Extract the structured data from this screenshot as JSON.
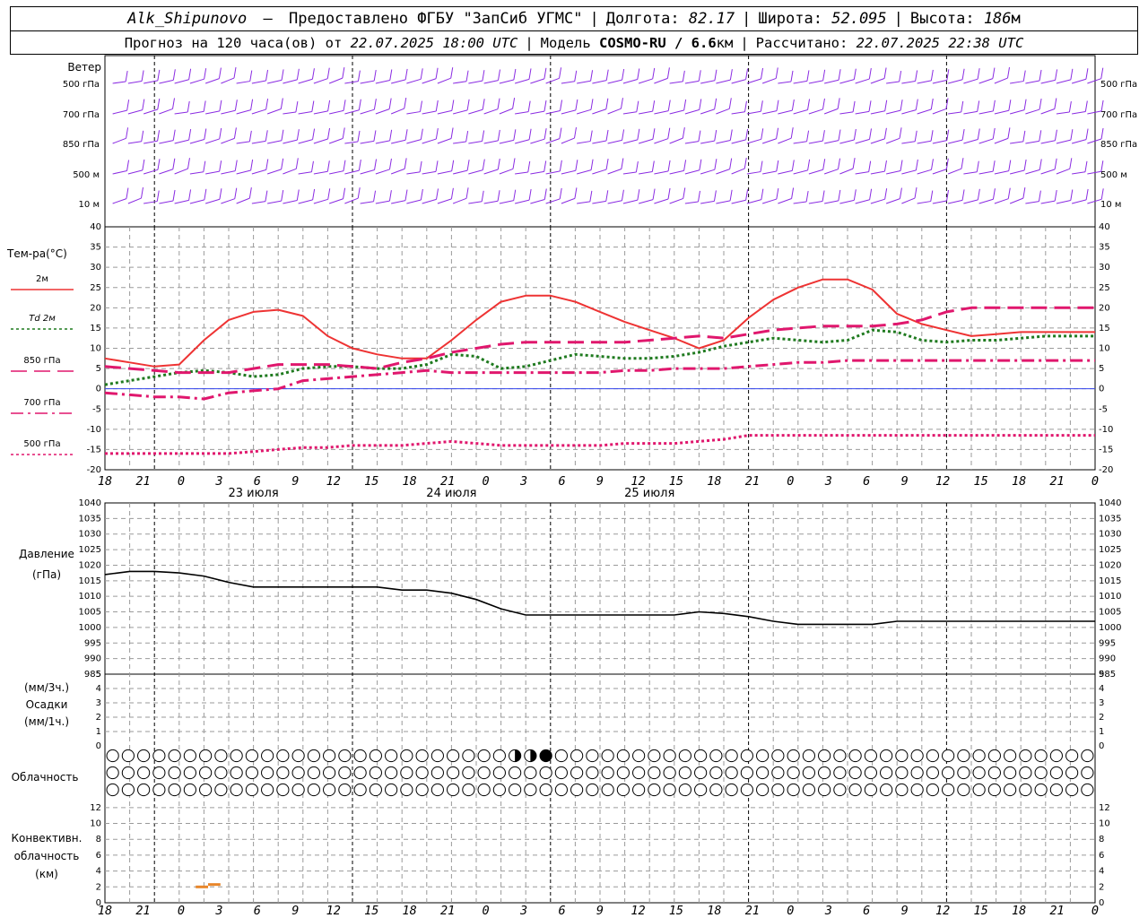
{
  "header": {
    "station": "Alk_Shipunovo",
    "provider": "Предоставлено ФГБУ \"ЗапСиб УГМС\"",
    "lon_label": "Долгота:",
    "lon_value": "82.17",
    "lat_label": "Широта:",
    "lat_value": "52.095",
    "alt_label": "Высота:",
    "alt_value": "186",
    "alt_unit": "м",
    "forecast_prefix": "Прогноз на 120 часа(ов) от",
    "forecast_time": "22.07.2025 18:00 UTC",
    "model_label": "Модель",
    "model_name": "COSMO-RU / 6.6",
    "model_unit": "км",
    "calc_label": "Рассчитано:",
    "calc_time": "22.07.2025 22:38 UTC"
  },
  "chart_data": [
    {
      "type": "wind-barbs",
      "label": "Ветер",
      "levels": [
        "500 гПа",
        "700 гПа",
        "850 гПа",
        "500 м",
        "10 м"
      ],
      "colors": {
        "barb": "#8a2be2"
      },
      "barbs_per_level": 64
    },
    {
      "type": "line",
      "label": "Тем-ра(°С)",
      "ylim": [
        -20,
        40
      ],
      "yticks": [
        -20,
        -15,
        -10,
        -5,
        0,
        5,
        10,
        15,
        20,
        25,
        30,
        35,
        40
      ],
      "x_hours": [
        0,
        120
      ],
      "series": [
        {
          "name": "2м",
          "color": "#ee3333",
          "style": "solid",
          "width": 2,
          "x": [
            0,
            3,
            6,
            9,
            12,
            15,
            18,
            21,
            24,
            27,
            30,
            33,
            36,
            39,
            42,
            45,
            48,
            51,
            54,
            57,
            60,
            63,
            66,
            69,
            72,
            75,
            78,
            81,
            84,
            87,
            90,
            93,
            96,
            99,
            102,
            105,
            108,
            111,
            114,
            117,
            120
          ],
          "y": [
            7.5,
            6.5,
            5.5,
            6,
            12,
            17,
            19,
            19.5,
            18,
            13,
            10,
            8.5,
            7.5,
            7.5,
            12,
            17,
            21.5,
            23,
            23,
            21.5,
            19,
            16.5,
            14.5,
            12.5,
            10,
            12,
            17.5,
            22,
            25,
            27,
            27,
            24.5,
            18.5,
            16,
            14.5,
            13,
            13.5,
            14,
            14,
            14,
            14
          ]
        },
        {
          "name": "Td 2м",
          "color": "#1f7a1f",
          "style": "dotted",
          "width": 3,
          "x": [
            0,
            3,
            6,
            9,
            12,
            15,
            18,
            21,
            24,
            27,
            30,
            33,
            36,
            39,
            42,
            45,
            48,
            51,
            54,
            57,
            60,
            63,
            66,
            69,
            72,
            75,
            78,
            81,
            84,
            87,
            90,
            93,
            96,
            99,
            102,
            105,
            108,
            111,
            114,
            117,
            120
          ],
          "y": [
            1,
            2,
            3,
            4,
            4.5,
            4,
            3,
            3.5,
            5,
            5.5,
            5.5,
            5,
            5,
            6,
            8.5,
            8,
            5,
            5.5,
            7,
            8.5,
            8,
            7.5,
            7.5,
            8,
            9,
            10.5,
            11.5,
            12.5,
            12,
            11.5,
            12,
            14.5,
            14,
            12,
            11.5,
            12,
            12,
            12.5,
            13,
            13,
            13
          ]
        },
        {
          "name": "850 гПа",
          "color": "#e0176d",
          "style": "longdash",
          "width": 3,
          "x": [
            0,
            3,
            6,
            9,
            12,
            15,
            18,
            21,
            24,
            27,
            30,
            33,
            36,
            39,
            42,
            45,
            48,
            51,
            54,
            57,
            60,
            63,
            66,
            69,
            72,
            75,
            78,
            81,
            84,
            87,
            90,
            93,
            96,
            99,
            102,
            105,
            108,
            111,
            114,
            117,
            120
          ],
          "y": [
            5.5,
            5,
            4.5,
            4,
            4,
            4,
            5,
            6,
            6,
            6,
            5.5,
            5,
            6.5,
            7.5,
            9,
            10,
            11,
            11.5,
            11.5,
            11.5,
            11.5,
            11.5,
            12,
            12.5,
            13,
            12.5,
            13.5,
            14.5,
            15,
            15.5,
            15.5,
            15.5,
            16,
            17,
            19,
            20,
            20,
            20,
            20,
            20,
            20
          ]
        },
        {
          "name": "700 гПа",
          "color": "#e0176d",
          "style": "dashdot",
          "width": 3,
          "x": [
            0,
            3,
            6,
            9,
            12,
            15,
            18,
            21,
            24,
            27,
            30,
            33,
            36,
            39,
            42,
            45,
            48,
            51,
            54,
            57,
            60,
            63,
            66,
            69,
            72,
            75,
            78,
            81,
            84,
            87,
            90,
            93,
            96,
            99,
            102,
            105,
            108,
            111,
            114,
            117,
            120
          ],
          "y": [
            -1,
            -1.5,
            -2,
            -2,
            -2.5,
            -1,
            -0.5,
            0,
            2,
            2.5,
            3,
            3.5,
            4,
            4.5,
            4,
            4,
            4,
            4,
            4,
            4,
            4,
            4.5,
            4.5,
            5,
            5,
            5,
            5.5,
            6,
            6.5,
            6.5,
            7,
            7,
            7,
            7,
            7,
            7,
            7,
            7,
            7,
            7,
            7
          ]
        },
        {
          "name": "500 гПа",
          "color": "#e0176d",
          "style": "dotted",
          "width": 3,
          "x": [
            0,
            3,
            6,
            9,
            12,
            15,
            18,
            21,
            24,
            27,
            30,
            33,
            36,
            39,
            42,
            45,
            48,
            51,
            54,
            57,
            60,
            63,
            66,
            69,
            72,
            75,
            78,
            81,
            84,
            87,
            90,
            93,
            96,
            99,
            102,
            105,
            108,
            111,
            114,
            117,
            120
          ],
          "y": [
            -16,
            -16,
            -16,
            -16,
            -16,
            -16,
            -15.5,
            -15,
            -14.5,
            -14.5,
            -14,
            -14,
            -14,
            -13.5,
            -13,
            -13.5,
            -14,
            -14,
            -14,
            -14,
            -14,
            -13.5,
            -13.5,
            -13.5,
            -13,
            -12.5,
            -11.5,
            -11.5,
            -11.5,
            -11.5,
            -11.5,
            -11.5,
            -11.5,
            -11.5,
            -11.5,
            -11.5,
            -11.5,
            -11.5,
            -11.5,
            -11.5,
            -11.5
          ]
        }
      ]
    },
    {
      "type": "line",
      "label_1": "Давление",
      "label_2": "(гПа)",
      "ylim": [
        985,
        1040
      ],
      "yticks": [
        985,
        990,
        995,
        1000,
        1005,
        1010,
        1015,
        1020,
        1025,
        1030,
        1035,
        1040
      ],
      "series": [
        {
          "name": "",
          "color": "#000000",
          "x": [
            0,
            3,
            6,
            9,
            12,
            15,
            18,
            21,
            24,
            27,
            30,
            33,
            36,
            39,
            42,
            45,
            48,
            51,
            54,
            57,
            60,
            63,
            66,
            69,
            72,
            75,
            78,
            81,
            84,
            87,
            90,
            93,
            96,
            99,
            102,
            105,
            108,
            111,
            114,
            117,
            120
          ],
          "y": [
            1017,
            1018,
            1018,
            1017.5,
            1016.5,
            1014.5,
            1013,
            1013,
            1013,
            1013,
            1013,
            1013,
            1012,
            1012,
            1011,
            1009,
            1006,
            1004,
            1004,
            1004,
            1004,
            1004,
            1004,
            1004,
            1005,
            1004.5,
            1003.5,
            1002,
            1001,
            1001,
            1001,
            1001,
            1002,
            1002,
            1002,
            1002,
            1002,
            1002,
            1002,
            1002,
            1002
          ]
        }
      ]
    },
    {
      "type": "bar",
      "label_1": "(мм/3ч.)",
      "label_2": "Осадки",
      "label_3": "(мм/1ч.)",
      "ylim": [
        0,
        5
      ],
      "yticks": [
        0,
        1,
        2,
        3,
        4,
        5
      ],
      "values": []
    },
    {
      "type": "cloud-cover",
      "label": "Облачность",
      "rows": [
        "0000000000000000000000000011200000000000000000000000000000000000",
        "0000000000000000000000000000000000000000000000000000000000000000",
        "0000000000000000000000000000000000000000000000000000000000000000"
      ],
      "values_per_row": 64
    },
    {
      "type": "bar",
      "label_1": "Конвективн.",
      "label_2": "облачность",
      "label_3": "(км)",
      "ylim": [
        0,
        13
      ],
      "yticks": [
        0,
        2,
        4,
        6,
        8,
        10,
        12
      ],
      "color": "#e8862a",
      "segments": [
        {
          "x_start": 11,
          "x_end": 12.5,
          "y": 2.0
        },
        {
          "x_start": 12.5,
          "x_end": 14,
          "y": 2.3
        }
      ]
    }
  ],
  "x_axis": {
    "tick_labels": [
      "18",
      "21",
      "0",
      "3",
      "6",
      "9",
      "12",
      "15",
      "18",
      "21",
      "0",
      "3",
      "6",
      "9",
      "12",
      "15",
      "18",
      "21",
      "0",
      "3",
      "6",
      "9",
      "12",
      "15",
      "18",
      "21",
      "0"
    ],
    "dates": [
      "23 июля",
      "24 июля",
      "25 июля"
    ]
  }
}
